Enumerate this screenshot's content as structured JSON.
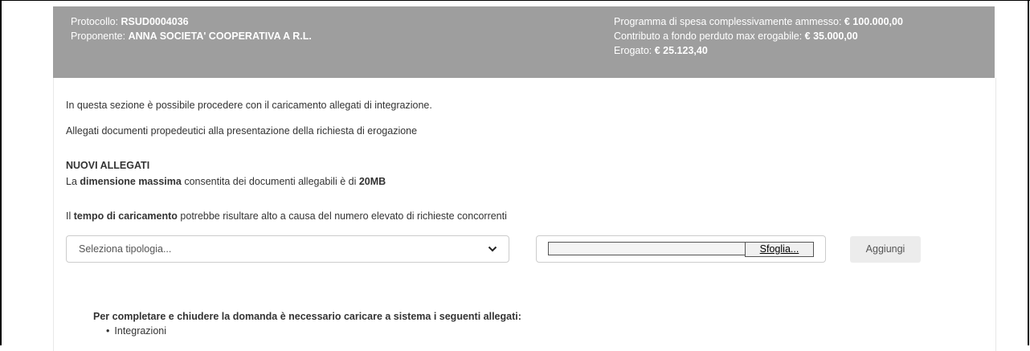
{
  "header": {
    "protocollo_label": "Protocollo: ",
    "protocollo_value": "RSUD0004036",
    "proponente_label": "Proponente: ",
    "proponente_value": "ANNA SOCIETA' COOPERATIVA A R.L.",
    "programma_label": "Programma di spesa complessivamente ammesso: ",
    "programma_value": "€ 100.000,00",
    "contributo_label": "Contributo a fondo perduto max erogabile: ",
    "contributo_value": "€ 35.000,00",
    "erogato_label": "Erogato: ",
    "erogato_value": "€ 25.123,40"
  },
  "content": {
    "intro_text": "In questa sezione è possibile procedere con il caricamento allegati di integrazione.",
    "allegati_text": "Allegati documenti propedeutici alla presentazione della richiesta di erogazione",
    "nuovi_allegati_title": "NUOVI ALLEGATI",
    "dim_prefix": "La ",
    "dim_bold": "dimensione massima",
    "dim_middle": " consentita dei documenti allegabili è di ",
    "dim_value": "20MB",
    "tempo_prefix": "Il ",
    "tempo_bold": "tempo di caricamento",
    "tempo_suffix": " potrebbe risultare alto a causa del numero elevato di richieste concorrenti"
  },
  "form": {
    "select_placeholder": "Seleziona tipologia...",
    "file_value": "",
    "browse_label": "Sfoglia...",
    "add_label": "Aggiungi"
  },
  "requirements": {
    "title": "Per completare e chiudere la domanda è necessario caricare a sistema i seguenti allegati:",
    "items": [
      "Integrazioni"
    ]
  },
  "colors": {
    "header_bg": "#9e9e9e",
    "header_text": "#ffffff",
    "body_text": "#333333",
    "button_bg": "#ececec"
  },
  "icons": {
    "select_arrow": "chevron-down-icon"
  }
}
